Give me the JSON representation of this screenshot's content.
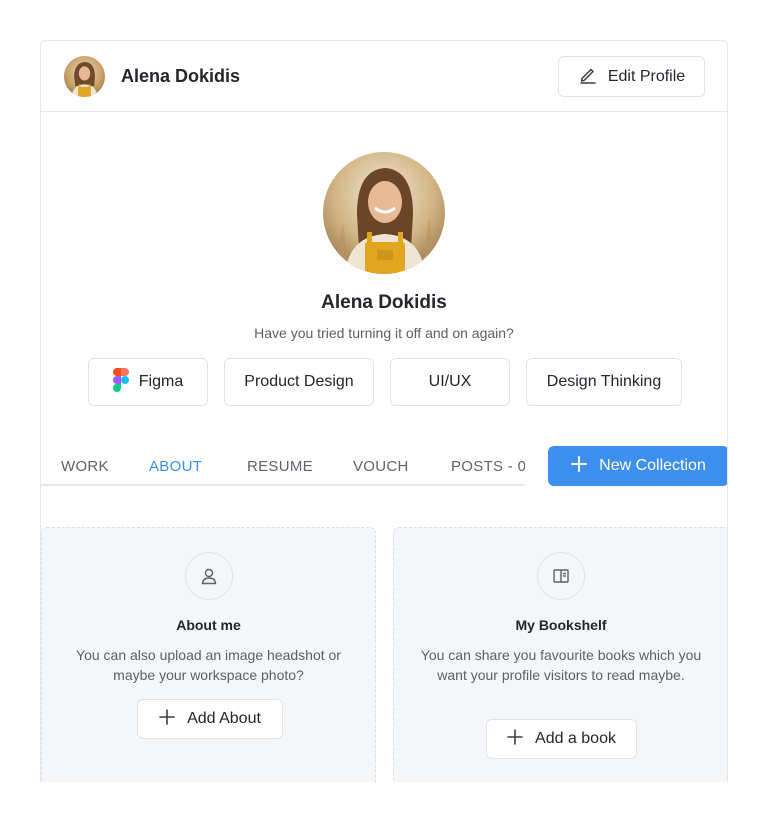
{
  "header": {
    "user_name": "Alena Dokidis",
    "edit_label": "Edit Profile"
  },
  "profile": {
    "name": "Alena Dokidis",
    "bio": "Have you tried turning it off and on again?"
  },
  "skills": [
    {
      "label": "Figma",
      "icon": "figma-icon"
    },
    {
      "label": "Product Design"
    },
    {
      "label": "UI/UX"
    },
    {
      "label": "Design Thinking"
    }
  ],
  "tabs": [
    {
      "label": "WORK",
      "active": false
    },
    {
      "label": "ABOUT",
      "active": true
    },
    {
      "label": "RESUME",
      "active": false
    },
    {
      "label": "VOUCH",
      "active": false
    },
    {
      "label": "POSTS - 0",
      "active": false
    }
  ],
  "new_collection_label": "New Collection",
  "panels": [
    {
      "icon": "user-icon",
      "title": "About me",
      "description": "You can also upload an image headshot or maybe your workspace photo?",
      "button_label": "Add About"
    },
    {
      "icon": "book-icon",
      "title": "My Bookshelf",
      "description": "You can share you favourite books which you want your profile visitors to read maybe.",
      "button_label": "Add a book"
    }
  ],
  "colors": {
    "accent": "#3d8ff0",
    "active_tab": "#3b8ee8",
    "panel_bg": "#f5f6f8"
  }
}
